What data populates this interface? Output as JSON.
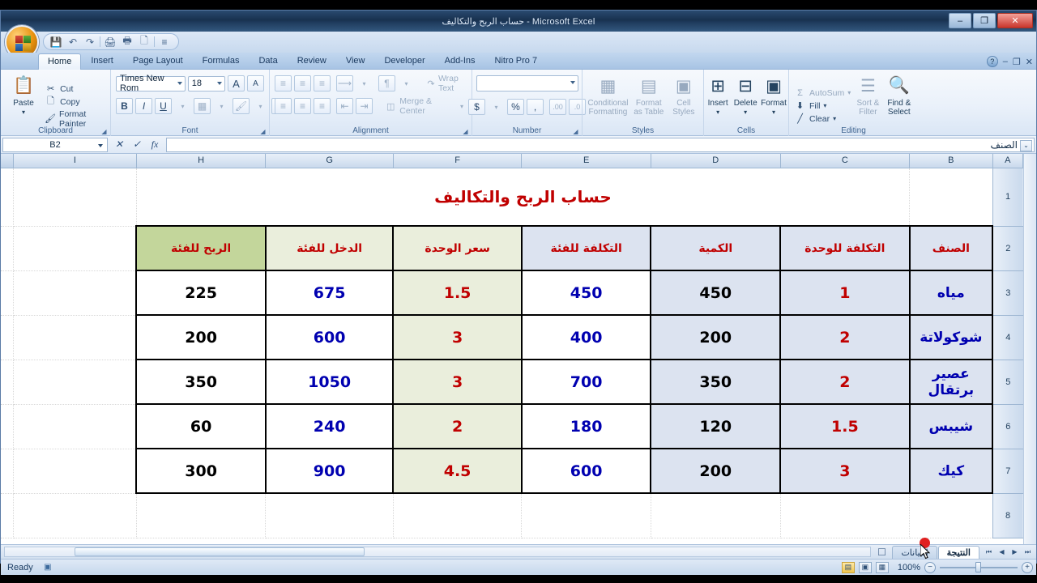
{
  "window": {
    "title": "حساب الربح والتكاليف - Microsoft Excel",
    "minimize": "–",
    "maximize": "❐",
    "close": "✕"
  },
  "quick_access": {
    "save": "save-icon",
    "undo": "undo-icon",
    "redo": "redo-icon",
    "print_preview": "print-preview-icon",
    "quick_print": "quick-print-icon",
    "new": "new-doc-icon",
    "customize": "customize-icon"
  },
  "ribbon": {
    "tabs": [
      {
        "label": "Home",
        "active": true
      },
      {
        "label": "Insert",
        "active": false
      },
      {
        "label": "Page Layout",
        "active": false
      },
      {
        "label": "Formulas",
        "active": false
      },
      {
        "label": "Data",
        "active": false
      },
      {
        "label": "Review",
        "active": false
      },
      {
        "label": "View",
        "active": false
      },
      {
        "label": "Developer",
        "active": false
      },
      {
        "label": "Add-Ins",
        "active": false
      },
      {
        "label": "Nitro Pro 7",
        "active": false
      }
    ],
    "help_label": "?",
    "win_minimize": "–",
    "win_restore": "❐",
    "win_close": "✕",
    "groups": {
      "clipboard": {
        "label": "Clipboard",
        "paste": "Paste",
        "cut": "Cut",
        "copy": "Copy",
        "format_painter": "Format Painter"
      },
      "font": {
        "label": "Font",
        "font_name": "Times New Rom",
        "font_size": "18",
        "grow_font": "A",
        "shrink_font": "A",
        "bold": "B",
        "italic": "I",
        "underline": "U",
        "borders": "borders-icon",
        "fill_color": "fill-color-icon",
        "font_color": "A"
      },
      "alignment": {
        "label": "Alignment",
        "align_top": "align-top-icon",
        "align_middle": "align-middle-icon",
        "align_bottom": "align-bottom-icon",
        "orientation": "orientation-icon",
        "rtl": "text-direction-icon",
        "align_left": "align-left-icon",
        "align_center": "align-center-icon",
        "align_right": "align-right-icon",
        "decrease_indent": "decrease-indent-icon",
        "increase_indent": "increase-indent-icon",
        "wrap_text": "Wrap Text",
        "merge_center": "Merge & Center"
      },
      "number": {
        "label": "Number",
        "format_value": "",
        "currency": "$",
        "percent": "%",
        "comma": ",",
        "increase_decimal": "increase-decimal-icon",
        "decrease_decimal": "decrease-decimal-icon"
      },
      "styles": {
        "label": "Styles",
        "conditional_formatting": "Conditional Formatting",
        "format_as_table": "Format as Table",
        "cell_styles": "Cell Styles"
      },
      "cells": {
        "label": "Cells",
        "insert": "Insert",
        "delete": "Delete",
        "format": "Format"
      },
      "editing": {
        "label": "Editing",
        "autosum": "AutoSum",
        "fill": "Fill",
        "clear": "Clear",
        "sort_filter": "Sort & Filter",
        "find_select": "Find & Select"
      }
    }
  },
  "formula_bar": {
    "name_box": "B2",
    "cancel": "✕",
    "enter": "✓",
    "insert_function": "fx",
    "formula_value": "الصنف",
    "expand": "⌄"
  },
  "grid": {
    "columns": [
      "I",
      "H",
      "G",
      "F",
      "E",
      "D",
      "C",
      "B",
      "A"
    ],
    "rows": [
      "1",
      "2",
      "3",
      "4",
      "5",
      "6",
      "7",
      "8"
    ],
    "sheet_title": "حساب الربح والتكاليف",
    "headers": [
      "الربح للفئة",
      "الدخل للفئة",
      "سعر الوحدة",
      "التكلفة للفئة",
      "الكمية",
      "التكلفة للوحدة",
      "الصنف"
    ],
    "rows_data": [
      {
        "profit": "225",
        "income": "675",
        "unit_price": "1.5",
        "category_cost": "450",
        "quantity": "450",
        "unit_cost": "1",
        "item": "مياه"
      },
      {
        "profit": "200",
        "income": "600",
        "unit_price": "3",
        "category_cost": "400",
        "quantity": "200",
        "unit_cost": "2",
        "item": "شوكولاتة"
      },
      {
        "profit": "350",
        "income": "1050",
        "unit_price": "3",
        "category_cost": "700",
        "quantity": "350",
        "unit_cost": "2",
        "item": "عصير برتقال"
      },
      {
        "profit": "60",
        "income": "240",
        "unit_price": "2",
        "category_cost": "180",
        "quantity": "120",
        "unit_cost": "1.5",
        "item": "شيبس"
      },
      {
        "profit": "300",
        "income": "900",
        "unit_price": "4.5",
        "category_cost": "600",
        "quantity": "200",
        "unit_cost": "3",
        "item": "كيك"
      }
    ]
  },
  "sheet_tabs": {
    "first": "⏮",
    "prev": "◀",
    "next": "▶",
    "last": "⏭",
    "tabs": [
      {
        "label": "النتيجة",
        "active": true
      },
      {
        "label": "البيانات",
        "active": false
      }
    ],
    "insert_sheet": "insert-sheet-icon"
  },
  "status_bar": {
    "state": "Ready",
    "macro_icon": "record-macro-icon",
    "normal_view": "normal-view-icon",
    "page_layout_view": "page-layout-view-icon",
    "page_break_view": "page-break-view-icon",
    "zoom_level": "100%",
    "zoom_out": "−",
    "zoom_in": "+"
  },
  "colors": {
    "title_red": "#c00000",
    "header_green": "#c3d69b",
    "header_cream": "#eaeedc",
    "header_blue": "#dce3f0",
    "value_blue": "#0000b0",
    "value_red": "#c00000"
  }
}
